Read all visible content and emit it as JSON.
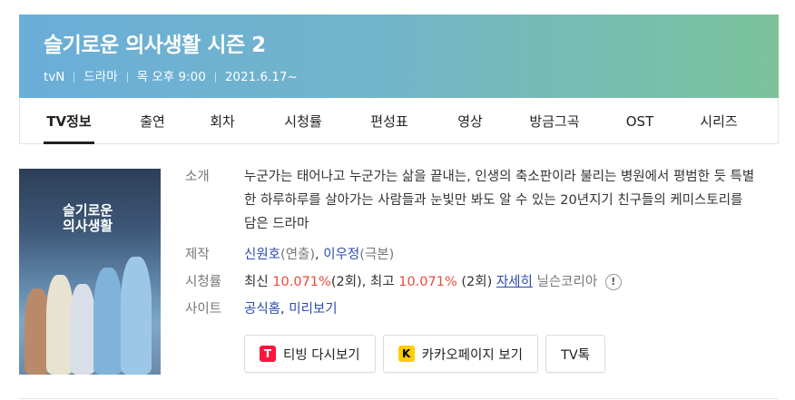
{
  "header": {
    "title": "슬기로운 의사생활 시즌 2",
    "channel": "tvN",
    "genre": "드라마",
    "schedule": "목 오후 9:00",
    "date": "2021.6.17~"
  },
  "tabs": [
    {
      "label": "TV정보",
      "active": true
    },
    {
      "label": "출연"
    },
    {
      "label": "회차"
    },
    {
      "label": "시청률"
    },
    {
      "label": "편성표"
    },
    {
      "label": "영상"
    },
    {
      "label": "방금그곡"
    },
    {
      "label": "OST"
    },
    {
      "label": "시리즈"
    }
  ],
  "poster": {
    "text_line1": "슬기로운",
    "text_line2": "의사생활"
  },
  "info": {
    "intro_label": "소개",
    "intro_text": "누군가는 태어나고 누군가는 삶을 끝내는, 인생의 축소판이라 불리는 병원에서 평범한 듯 특별한 하루하루를 살아가는 사람들과 눈빛만 봐도 알 수 있는 20년지기 친구들의 케미스토리를 담은 드라마",
    "production_label": "제작",
    "director": "신원호",
    "director_role": "(연출)",
    "writer": "이우정",
    "writer_role": "(극본)",
    "rating_label": "시청률",
    "latest_label": "최신",
    "latest_value": "10.071%",
    "latest_ep": "(2회)",
    "best_label": "최고",
    "best_value": "10.071%",
    "best_ep": "(2회)",
    "detail_link": "자세히",
    "source": "닐슨코리아",
    "site_label": "사이트",
    "site_home": "공식홈",
    "site_preview": "미리보기"
  },
  "buttons": {
    "tving": "티빙 다시보기",
    "kakao": "카카오페이지 보기",
    "talk": "TV톡"
  },
  "colors": {
    "accent_red": "#e84a3a",
    "link_blue": "#2a4bab"
  }
}
